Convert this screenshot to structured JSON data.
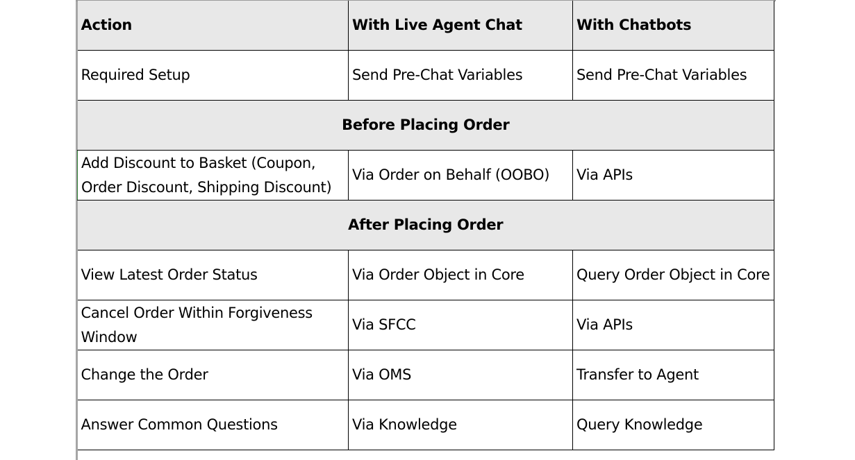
{
  "table": {
    "headers": [
      "Action",
      "With Live Agent Chat",
      "With Chatbots"
    ],
    "rows": [
      {
        "type": "data",
        "cells": [
          "Required Setup",
          "Send Pre-Chat Variables",
          "Send Pre-Chat Variables"
        ]
      },
      {
        "type": "section",
        "label": "Before Placing Order"
      },
      {
        "type": "data",
        "cells": [
          "Add Discount to Basket (Coupon, Order Discount, Shipping Discount)",
          "Via Order on Behalf (OOBO)",
          "Via APIs"
        ]
      },
      {
        "type": "section",
        "label": "After Placing Order"
      },
      {
        "type": "data",
        "cells": [
          "View Latest Order Status",
          "Via Order Object in Core",
          "Query Order Object in Core"
        ]
      },
      {
        "type": "data",
        "cells": [
          "Cancel Order Within Forgiveness Window",
          "Via SFCC",
          "Via APIs"
        ]
      },
      {
        "type": "data",
        "cells": [
          "Change the Order",
          "Via OMS",
          "Transfer to Agent"
        ]
      },
      {
        "type": "data",
        "cells": [
          "Answer Common Questions",
          "Via Knowledge",
          "Query Knowledge"
        ]
      }
    ]
  }
}
